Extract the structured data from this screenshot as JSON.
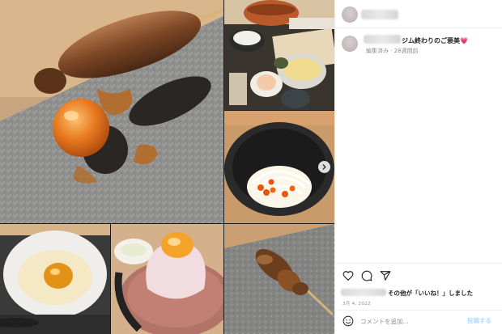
{
  "post": {
    "caption": "ジム終わりのご褒美",
    "caption_emoji": "💗",
    "meta": "編集済み · 28週間前",
    "likes_suffix": "その他が「いいね！」しました",
    "date": "3月 4, 2022"
  },
  "comment": {
    "placeholder": "コメントを追加...",
    "post_label": "投稿する"
  },
  "icons": [
    "heart-icon",
    "comment-icon",
    "share-icon",
    "emoji-icon",
    "chevron-right-icon"
  ],
  "colors": {
    "accent": "#0095f6",
    "secondary_text": "#8e8e8e",
    "border": "#efefef"
  }
}
